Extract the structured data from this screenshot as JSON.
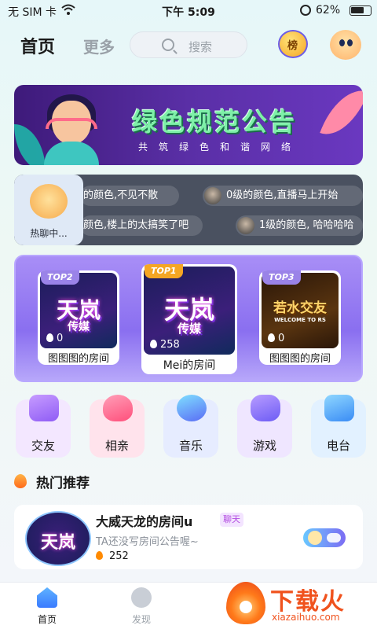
{
  "status_bar": {
    "carrier": "无 SIM 卡",
    "time": "下午 5:09",
    "battery": "62%"
  },
  "header": {
    "title": "首页",
    "more": "更多",
    "search_placeholder": "搜索",
    "rank_badge": "榜"
  },
  "banner": {
    "title": "绿色规范公告",
    "subtitle": "共筑绿色和谐网络"
  },
  "ticker": {
    "badge_label": "热聊中...",
    "messages": [
      {
        "text": "的颜色,不见不散"
      },
      {
        "text": "0级的颜色,直播马上开始"
      },
      {
        "text": "颜色,楼上的太搞笑了吧"
      },
      {
        "text": "1级的颜色, 哈哈哈哈"
      }
    ]
  },
  "top_rooms": [
    {
      "rank": "TOP2",
      "logo": "天岚",
      "logo_sub": "传媒",
      "heat": "0",
      "name": "图图图的房间"
    },
    {
      "rank": "TOP1",
      "logo": "天岚",
      "logo_sub": "传媒",
      "heat": "258",
      "name": "Mei的房间"
    },
    {
      "rank": "TOP3",
      "logo": "若水交友",
      "logo_sub": "WELCOME TO RS",
      "heat": "0",
      "name": "图图图的房间"
    }
  ],
  "categories": [
    {
      "label": "交友",
      "color": "#f3e7ff"
    },
    {
      "label": "相亲",
      "color": "#ffe3ec"
    },
    {
      "label": "音乐",
      "color": "#e6ecff"
    },
    {
      "label": "游戏",
      "color": "#efe6ff"
    },
    {
      "label": "电台",
      "color": "#e2f1ff"
    }
  ],
  "section": {
    "title": "热门推荐"
  },
  "recommend": {
    "cover_text": "天岚",
    "title": "大威天龙的房间u",
    "chip": "聊天",
    "notice": "TA还没写房间公告喔~",
    "heat": "252"
  },
  "tabbar": {
    "home": "首页",
    "discover": "发现"
  },
  "watermark": {
    "brand": "下载火",
    "domain": "xiazaihuo.com"
  },
  "colors": {
    "accent_purple": "#8a6ff0",
    "brand_orange": "#f0521d",
    "banner_green": "#7ef0a8"
  }
}
